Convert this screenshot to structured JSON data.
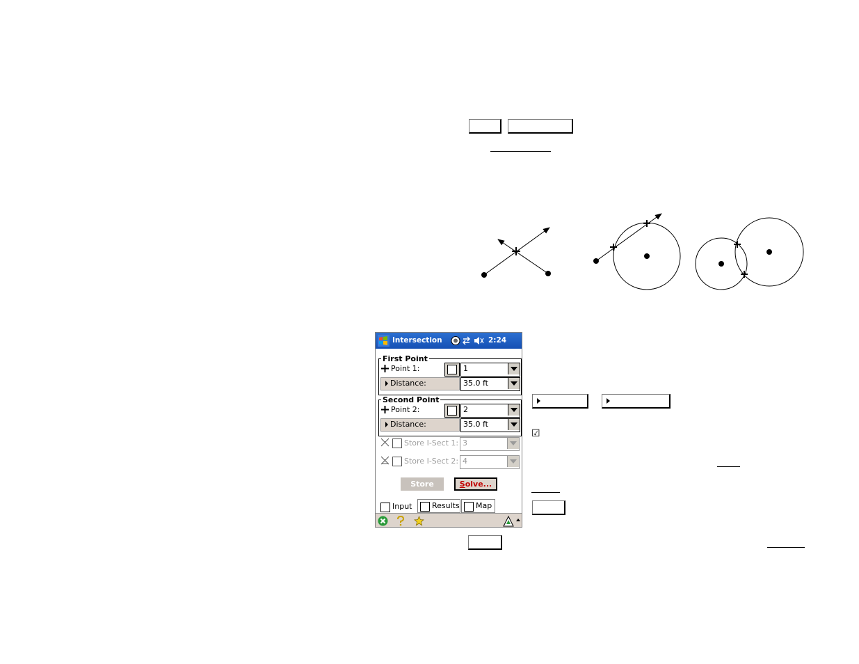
{
  "app": {
    "title": "Intersection",
    "clock": "2:24"
  },
  "first_point": {
    "legend": "First Point",
    "point_label": "Point 1:",
    "point_value": "1",
    "distance_label": "Distance:",
    "distance_value": "35.0 ft"
  },
  "second_point": {
    "legend": "Second Point",
    "point_label": "Point 2:",
    "point_value": "2",
    "distance_label": "Distance:",
    "distance_value": "35.0 ft"
  },
  "store": {
    "isect1_label": "Store I-Sect 1:",
    "isect1_value": "3",
    "isect2_label": "Store I-Sect 2:",
    "isect2_value": "4"
  },
  "buttons": {
    "store": "Store",
    "solve_prefix": "S",
    "solve_rest": "olve..."
  },
  "tabs": [
    "Input",
    "Results",
    "Map"
  ],
  "icons": [
    "windows-start-icon",
    "sync-icon",
    "volume-icon",
    "close-icon",
    "help-icon",
    "favorite-icon",
    "sip-icon",
    "cross-point-icon",
    "map-icon",
    "intersect-icon"
  ],
  "colors": {
    "title_bar": "#1f5cc4",
    "solve_text": "#c00000",
    "panel_bg": "#ddd4cc"
  },
  "document_checkbox_glyph": "☑"
}
